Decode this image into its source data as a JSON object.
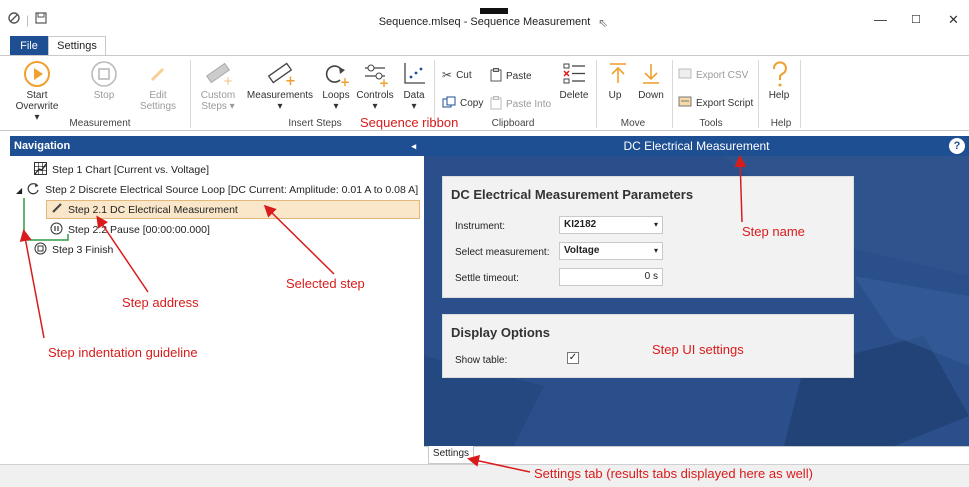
{
  "window": {
    "title": "Sequence.mlseq - Sequence Measurement",
    "minimize": "—",
    "maximize": "☐",
    "close": "✕"
  },
  "tabs": [
    {
      "label": "File"
    },
    {
      "label": "Settings"
    }
  ],
  "ribbon": {
    "start_label": "Start",
    "start_sub": "Overwrite ▾",
    "stop_label": "Stop",
    "edit_label": "Edit",
    "edit_sub": "Settings",
    "custom_label": "Custom",
    "custom_sub": "Steps ▾",
    "measurements_label": "Measurements",
    "loops_label": "Loops",
    "controls_label": "Controls",
    "data_label": "Data",
    "cut_label": "Cut",
    "copy_label": "Copy",
    "paste_label": "Paste",
    "paste_into_label": "Paste Into",
    "delete_label": "Delete",
    "up_label": "Up",
    "down_label": "Down",
    "export_csv_label": "Export CSV",
    "export_script_label": "Export Script",
    "help_label": "Help",
    "dropdown_caret": "▾",
    "groups": {
      "measurement": "Measurement",
      "insert_steps": "Insert Steps",
      "clipboard": "Clipboard",
      "move": "Move",
      "tools": "Tools",
      "help": "Help"
    }
  },
  "navigation": {
    "header": "Navigation",
    "collapse_glyph": "◂",
    "expander_glyph": "◢",
    "steps": [
      {
        "label": "Step 1 Chart [Current vs. Voltage]"
      },
      {
        "label": "Step 2 Discrete Electrical Source Loop [DC Current: Amplitude: 0.01 A to 0.08 A]"
      },
      {
        "label": "Step 2.1 DC Electrical Measurement"
      },
      {
        "label": "Step 2.2 Pause [00:00:00.000]"
      },
      {
        "label": "Step 3 Finish"
      }
    ]
  },
  "step_panel": {
    "header": "DC Electrical Measurement",
    "help_glyph": "?",
    "params_title": "DC Electrical Measurement Parameters",
    "instrument_label": "Instrument:",
    "instrument_value": "KI2182",
    "measurement_label": "Select measurement:",
    "measurement_value": "Voltage",
    "timeout_label": "Settle timeout:",
    "timeout_value": "0 s",
    "display_title": "Display Options",
    "show_table_label": "Show table:",
    "show_table_checked": "✓"
  },
  "bottom_tab": "Settings",
  "annotations": {
    "sequence_ribbon": "Sequence ribbon",
    "step_name": "Step name",
    "selected_step": "Selected step",
    "step_address": "Step address",
    "step_indentation": "Step indentation guideline",
    "step_ui_settings": "Step UI settings",
    "settings_tab": "Settings tab (results tabs displayed here as well)"
  },
  "colors": {
    "accent": "#1e4f92",
    "annotation": "#d91b1b",
    "selection": "#fae6c9",
    "orange_icon": "#f0a030",
    "guideline": "#2e9b3e"
  }
}
